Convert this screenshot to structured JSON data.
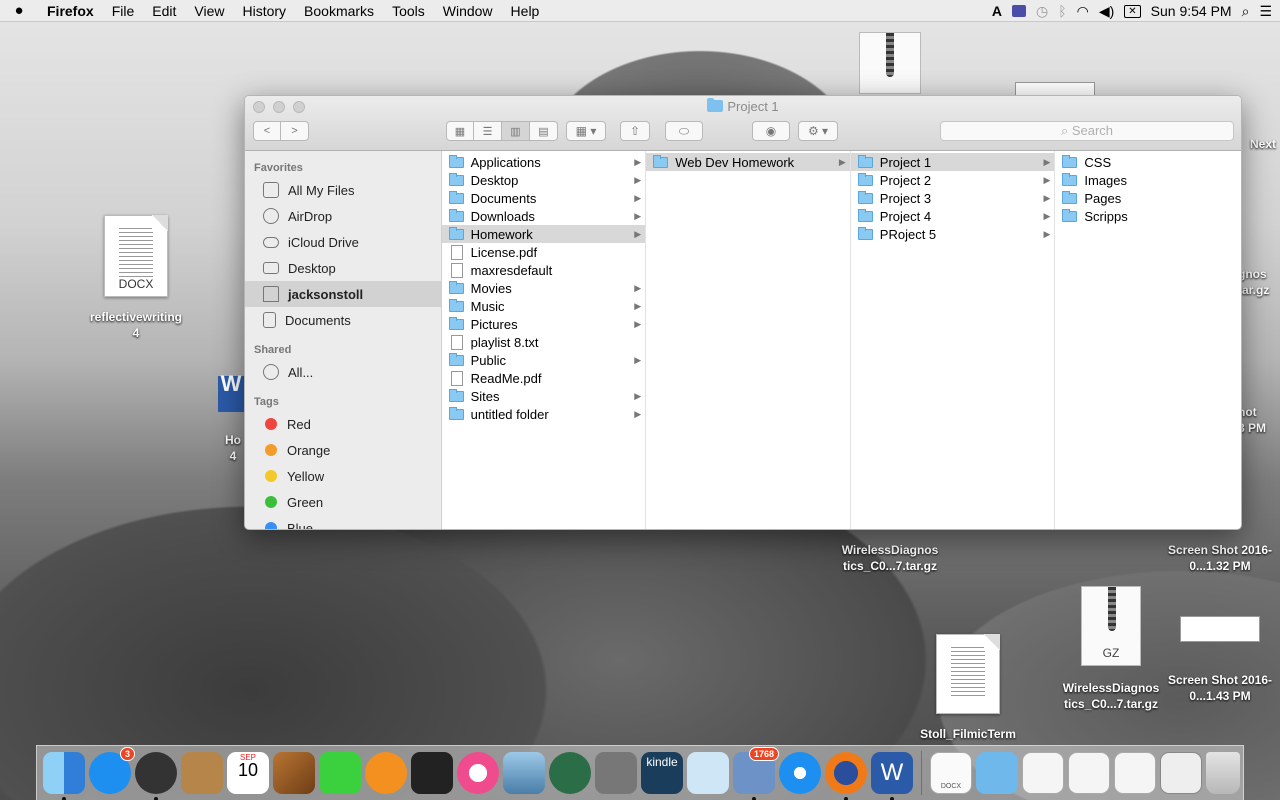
{
  "menubar": {
    "app_name": "Firefox",
    "menus": [
      "File",
      "Edit",
      "View",
      "History",
      "Bookmarks",
      "Tools",
      "Window",
      "Help"
    ],
    "clock": "Sun 9:54 PM",
    "status_icons": [
      "adobe-icon",
      "square-app-icon",
      "time-machine-icon",
      "bluetooth-icon",
      "wifi-icon",
      "volume-icon",
      "battery-icon"
    ]
  },
  "desktop": {
    "icons": [
      {
        "label": "reflectivewriting\n4",
        "badge": "DOCX"
      },
      {
        "label": "WirelessDiagnos tics_C0...7.tar.gz"
      },
      {
        "label": "Screen Shot 2016-0...1.32 PM"
      },
      {
        "label": "WirelessDiagnos tics_C0...7.tar.gz",
        "badge": "GZ"
      },
      {
        "label": "Screen Shot 2016-0...1.43 PM"
      },
      {
        "label": "Stoll_FilmicTerm"
      }
    ],
    "partial_labels": {
      "next": "Next",
      "ho": "Ho",
      "four": "4",
      "ignos": "gnos",
      "targz": "tar.gz",
      "hot": "hot",
      "pm": "8 PM"
    }
  },
  "finder": {
    "title": "Project 1",
    "search_placeholder": "Search",
    "sidebar": {
      "favorites_header": "Favorites",
      "favorites": [
        "All My Files",
        "AirDrop",
        "iCloud Drive",
        "Desktop",
        "jacksonstoll",
        "Documents"
      ],
      "shared_header": "Shared",
      "shared": [
        "All..."
      ],
      "tags_header": "Tags",
      "tags": [
        {
          "label": "Red",
          "color": "#f0443e"
        },
        {
          "label": "Orange",
          "color": "#f49b2c"
        },
        {
          "label": "Yellow",
          "color": "#f3c92a"
        },
        {
          "label": "Green",
          "color": "#3bbf3b"
        },
        {
          "label": "Blue",
          "color": "#3a8ff5"
        }
      ]
    },
    "columns": [
      [
        "Applications",
        "Desktop",
        "Documents",
        "Downloads",
        "Homework",
        "License.pdf",
        "maxresdefault",
        "Movies",
        "Music",
        "Pictures",
        "playlist 8.txt",
        "Public",
        "ReadMe.pdf",
        "Sites",
        "untitled folder"
      ],
      [
        "Web Dev Homework"
      ],
      [
        "Project 1",
        "Project 2",
        "Project 3",
        "Project 4",
        "PRoject 5"
      ],
      [
        "CSS",
        "Images",
        "Pages",
        "Scripps"
      ]
    ]
  },
  "dock": {
    "app_store_badge": "3",
    "mail_badge": "1768",
    "calendar_month": "SEP",
    "calendar_day": "10",
    "kindle_label": "kindle",
    "word_label": "W",
    "docx_label": "DOCX"
  }
}
